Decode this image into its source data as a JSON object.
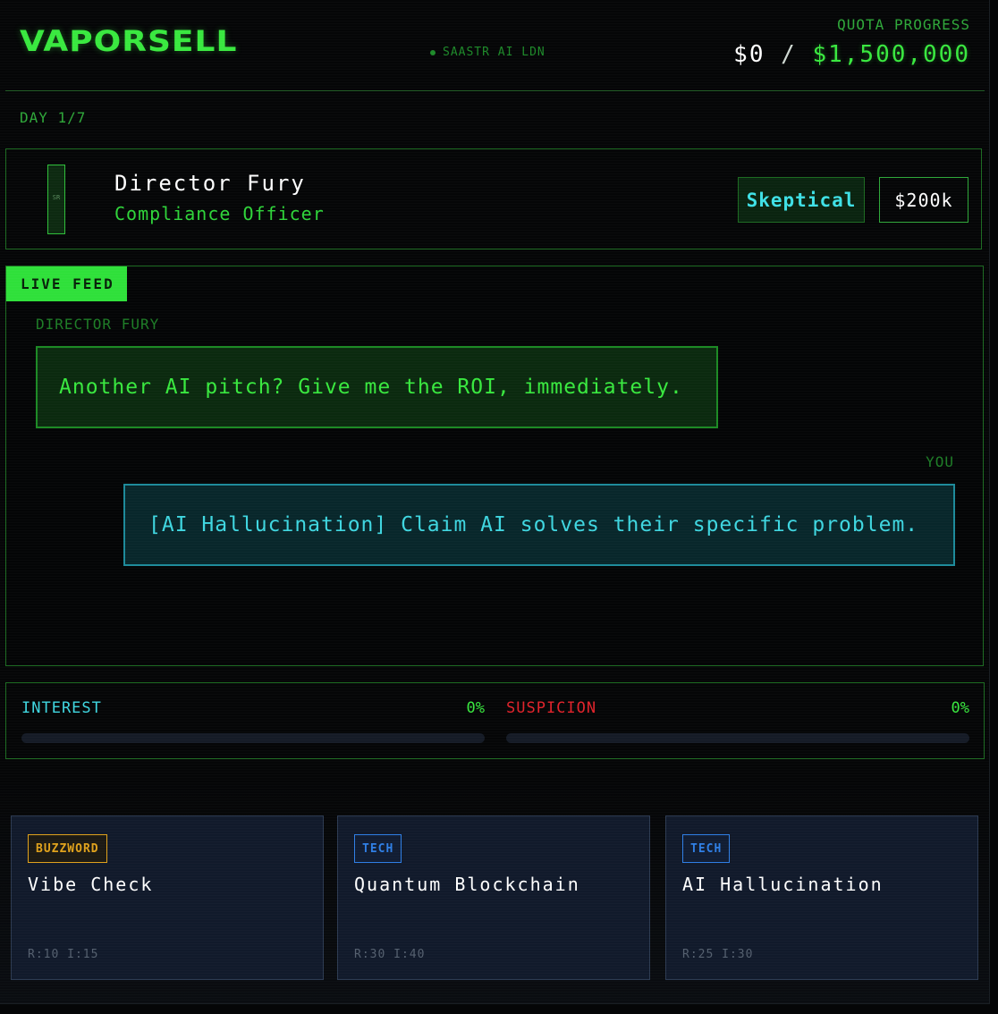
{
  "header": {
    "logo": "VAPORSELL",
    "event": "SAASTR AI LDN",
    "quota_label": "QUOTA PROGRESS",
    "quota_current": "$0",
    "quota_separator": "/",
    "quota_goal": "$1,500,000"
  },
  "day": "DAY 1/7",
  "prospect": {
    "avatar_text": "SR",
    "name": "Director Fury",
    "role": "Compliance Officer",
    "mood": "Skeptical",
    "deal_value": "$200k"
  },
  "feed": {
    "tag": "LIVE FEED",
    "messages": [
      {
        "speaker": "DIRECTOR FURY",
        "text": "Another AI pitch? Give me the ROI, immediately."
      },
      {
        "speaker": "YOU",
        "text": "[AI Hallucination] Claim AI solves their specific problem."
      }
    ]
  },
  "meters": [
    {
      "label": "INTEREST",
      "value_text": "0%",
      "value": 0
    },
    {
      "label": "SUSPICION",
      "value_text": "0%",
      "value": 0
    }
  ],
  "cards": [
    {
      "tag": "BUZZWORD",
      "title": "Vibe Check",
      "stats": "R:10 I:15"
    },
    {
      "tag": "TECH",
      "title": "Quantum Blockchain",
      "stats": "R:30 I:40"
    },
    {
      "tag": "TECH",
      "title": "AI Hallucination",
      "stats": "R:25 I:30"
    }
  ],
  "colors": {
    "accent": "#39e83f",
    "cyan": "#3fd6e0",
    "danger": "#e0232b",
    "buzzword": "#e0a21c",
    "tech": "#2f7fe6"
  }
}
